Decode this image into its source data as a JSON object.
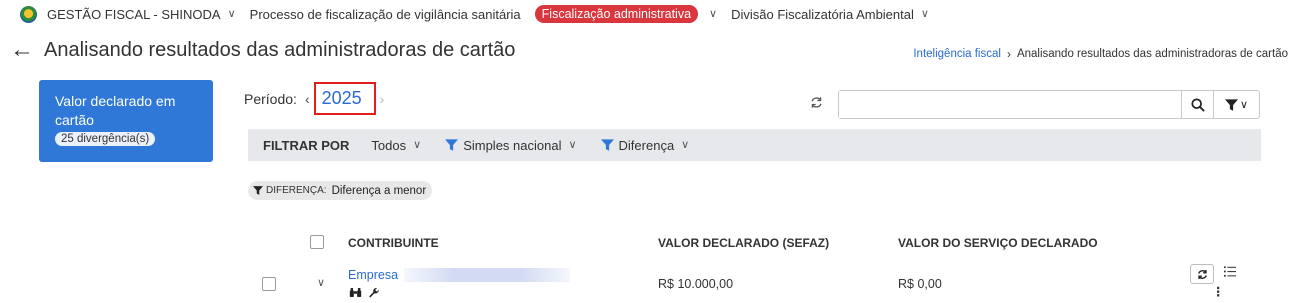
{
  "nav": {
    "items": [
      {
        "label": "GESTÃO FISCAL - SHINODA"
      },
      {
        "label": "Processo de fiscalização de vigilância sanitária"
      },
      {
        "label": "Fiscalização administrativa"
      },
      {
        "label": "Divisão Fiscalizatória Ambiental"
      }
    ],
    "active_color": "#d9363e"
  },
  "page": {
    "title": "Analisando resultados das administradoras de cartão",
    "breadcrumb": [
      "Inteligência fiscal",
      "Analisando resultados das administradoras de cartão"
    ]
  },
  "card": {
    "title": "Valor declarado em cartão",
    "badge": "25 divergência(s)",
    "color": "#2f78d8"
  },
  "period": {
    "label": "Período:",
    "year": "2025"
  },
  "search": {
    "value": "",
    "placeholder": ""
  },
  "filters": {
    "label": "FILTRAR POR",
    "items": [
      "Todos",
      "Simples nacional",
      "Diferença"
    ]
  },
  "active_filter": {
    "key": "DIFERENÇA:",
    "value": "Diferença a menor"
  },
  "table": {
    "columns": [
      "CONTRIBUINTE",
      "VALOR DECLARADO (SEFAZ)",
      "VALOR DO SERVIÇO DECLARADO"
    ],
    "rows": [
      {
        "contribuinte": "Empresa",
        "valor_declarado": "R$ 10.000,00",
        "valor_servico": "R$ 0,00"
      }
    ]
  },
  "icons": [
    "brand-icon",
    "back-arrow-icon",
    "refresh-icon",
    "search-icon",
    "filter-icon",
    "funnel-icon",
    "binoculars-icon",
    "wrench-icon",
    "list-icon",
    "kebab-icon",
    "chevron-down-icon"
  ]
}
